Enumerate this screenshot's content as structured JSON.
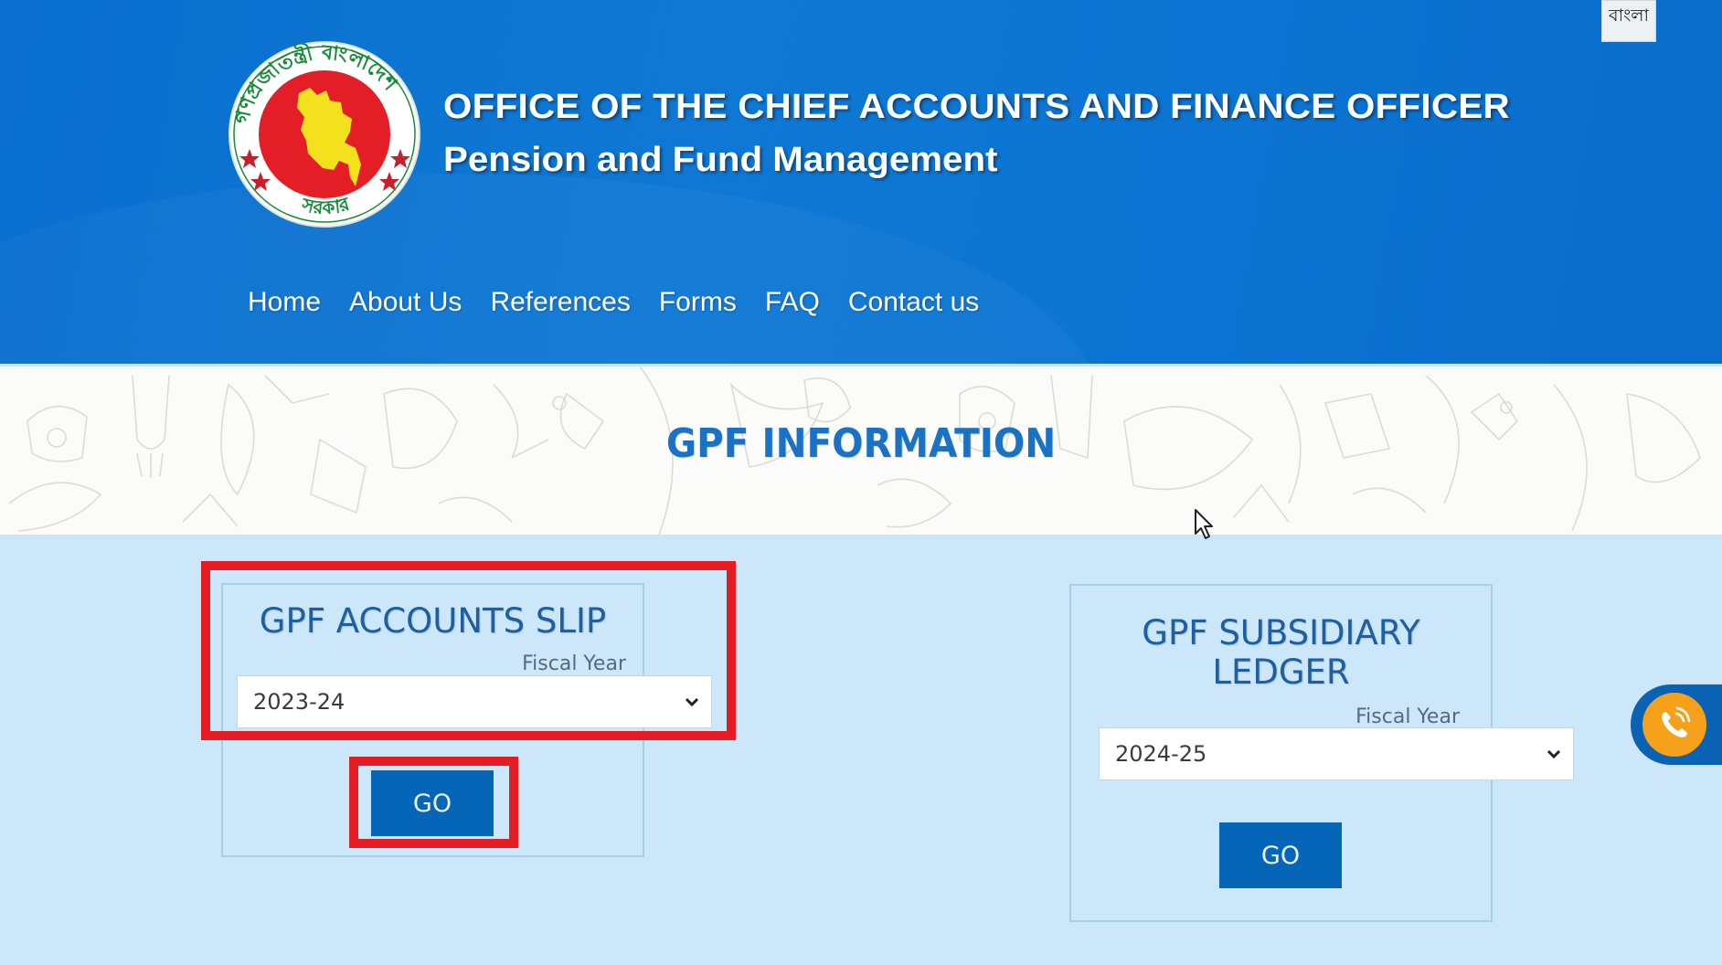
{
  "header": {
    "language_toggle": "বাংলা",
    "logo_alt": "Government of the People's Republic of Bangladesh seal",
    "title_line1": "OFFICE OF THE CHIEF ACCOUNTS AND FINANCE OFFICER",
    "title_line2": "Pension and Fund Management",
    "nav": [
      {
        "label": "Home"
      },
      {
        "label": "About Us"
      },
      {
        "label": "References"
      },
      {
        "label": "Forms"
      },
      {
        "label": "FAQ"
      },
      {
        "label": "Contact us"
      }
    ]
  },
  "section": {
    "title": "GPF INFORMATION"
  },
  "cards": [
    {
      "title": "GPF ACCOUNTS SLIP",
      "fiscal_year_label": "Fiscal Year",
      "fiscal_year_value": "2023-24",
      "button_label": "GO"
    },
    {
      "title": "GPF SUBSIDIARY LEDGER",
      "fiscal_year_label": "Fiscal Year",
      "fiscal_year_value": "2024-25",
      "button_label": "GO"
    }
  ],
  "colors": {
    "header_blue": "#0f78d4",
    "page_bg": "#cce7fa",
    "title_blue": "#1a72c4",
    "button_blue": "#0566b8",
    "highlight_red": "#e51c24",
    "call_orange": "#f5a11c"
  },
  "icons": {
    "call": "phone-call-icon",
    "chevron": "chevron-down-icon",
    "cursor": "mouse-pointer-icon"
  }
}
